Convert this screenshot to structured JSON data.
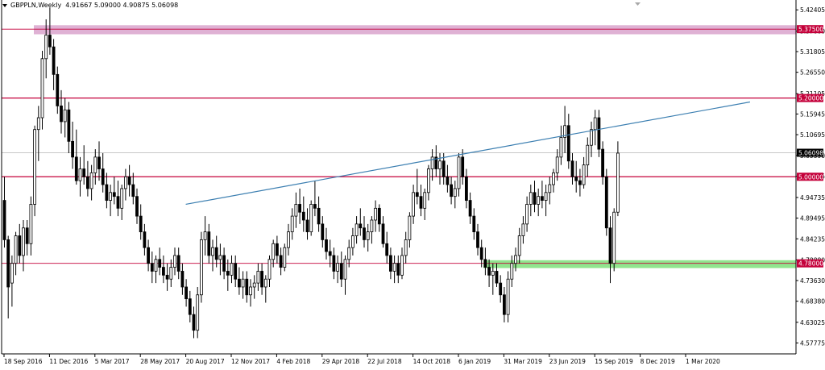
{
  "header": {
    "symbol_timeframe": "GBPPLN,Weekly",
    "ohlc": "4.91667 5.09000 4.90875 5.06098"
  },
  "colors": {
    "background": "#ffffff",
    "candle_outline": "#000000",
    "bull_fill": "#ffffff",
    "bear_fill": "#000000",
    "level_line": "#c4003a",
    "resistance_zone": "#d9a3cc",
    "support_zone": "#7ee07a",
    "trendline": "#3c7fb1",
    "price_label_bg": "#c4003a",
    "price_label_text": "#ffffff",
    "current_price_bg": "#000000"
  },
  "chart_data": {
    "type": "candlestick",
    "title": "GBPPLN,Weekly",
    "ylim": [
      4.55,
      5.445
    ],
    "y_ticks": [
      "5.42405",
      "5.37000",
      "5.31805",
      "5.26550",
      "5.21105",
      "5.15945",
      "5.10695",
      "5.05390",
      "5.00135",
      "4.94735",
      "4.89495",
      "4.84235",
      "4.78880",
      "4.73630",
      "4.68380",
      "4.63025",
      "4.57775"
    ],
    "x_labels": [
      "18 Sep 2016",
      "11 Dec 2016",
      "5 Mar 2017",
      "28 May 2017",
      "20 Aug 2017",
      "12 Nov 2017",
      "4 Feb 2018",
      "29 Apr 2018",
      "22 Jul 2018",
      "14 Oct 2018",
      "6 Jan 2019",
      "31 Mar 2019",
      "23 Jun 2019",
      "15 Sep 2019",
      "8 Dec 2019",
      "1 Mar 2020"
    ],
    "horizontal_levels": [
      {
        "value": 5.375,
        "label": "5.37500"
      },
      {
        "value": 5.2,
        "label": "5.20000"
      },
      {
        "value": 5.0,
        "label": "5.00000"
      },
      {
        "value": 4.78,
        "label": "4.78000"
      }
    ],
    "current_price": {
      "value": 5.06098,
      "label": "5.06098"
    },
    "zones": [
      {
        "name": "resistance",
        "from": 5.362,
        "to": 5.385
      },
      {
        "name": "support",
        "from": 4.768,
        "to": 4.788
      }
    ],
    "trendline": {
      "start": [
        "2017-08-20",
        4.93
      ],
      "end": [
        "2020-06-28",
        5.19
      ]
    },
    "series": [
      {
        "ohlc": [
          [
            4.94,
            5.0,
            4.82,
            4.84
          ],
          [
            4.84,
            4.85,
            4.64,
            4.72
          ],
          [
            4.73,
            4.8,
            4.67,
            4.78
          ],
          [
            4.78,
            4.86,
            4.75,
            4.85
          ],
          [
            4.85,
            4.88,
            4.78,
            4.8
          ],
          [
            4.8,
            4.89,
            4.76,
            4.87
          ],
          [
            4.87,
            4.89,
            4.8,
            4.83
          ],
          [
            4.83,
            4.95,
            4.8,
            4.93
          ],
          [
            4.93,
            5.13,
            4.9,
            5.12
          ],
          [
            5.12,
            5.18,
            5.04,
            5.15
          ],
          [
            5.15,
            5.32,
            5.12,
            5.3
          ],
          [
            5.3,
            5.4,
            5.25,
            5.36
          ],
          [
            5.36,
            5.43,
            5.31,
            5.33
          ],
          [
            5.33,
            5.35,
            5.22,
            5.26
          ],
          [
            5.26,
            5.28,
            5.16,
            5.18
          ],
          [
            5.18,
            5.22,
            5.11,
            5.14
          ],
          [
            5.14,
            5.2,
            5.1,
            5.17
          ],
          [
            5.17,
            5.19,
            5.06,
            5.09
          ],
          [
            5.09,
            5.14,
            5.02,
            5.05
          ],
          [
            5.05,
            5.12,
            4.98,
            4.99
          ],
          [
            4.99,
            5.05,
            4.95,
            5.02
          ],
          [
            5.02,
            5.08,
            4.98,
            5.0
          ],
          [
            5.0,
            5.04,
            4.95,
            4.97
          ],
          [
            4.97,
            5.03,
            4.94,
            5.01
          ],
          [
            5.01,
            5.07,
            4.98,
            5.05
          ],
          [
            5.05,
            5.09,
            4.99,
            5.02
          ],
          [
            5.02,
            5.06,
            4.96,
            4.98
          ],
          [
            4.98,
            5.01,
            4.92,
            4.94
          ],
          [
            4.94,
            4.98,
            4.9,
            4.96
          ],
          [
            4.96,
            5.0,
            4.93,
            4.95
          ],
          [
            4.95,
            4.99,
            4.9,
            4.92
          ],
          [
            4.92,
            4.98,
            4.89,
            4.97
          ],
          [
            4.97,
            5.02,
            4.94,
            5.0
          ],
          [
            5.0,
            5.03,
            4.95,
            4.98
          ],
          [
            4.98,
            5.01,
            4.93,
            4.95
          ],
          [
            4.95,
            4.97,
            4.88,
            4.9
          ],
          [
            4.9,
            4.93,
            4.84,
            4.86
          ],
          [
            4.86,
            4.88,
            4.8,
            4.82
          ],
          [
            4.82,
            4.84,
            4.76,
            4.78
          ],
          [
            4.78,
            4.81,
            4.73,
            4.76
          ],
          [
            4.76,
            4.8,
            4.73,
            4.79
          ],
          [
            4.79,
            4.82,
            4.75,
            4.77
          ],
          [
            4.77,
            4.8,
            4.73,
            4.75
          ],
          [
            4.75,
            4.78,
            4.71,
            4.74
          ],
          [
            4.74,
            4.79,
            4.72,
            4.77
          ],
          [
            4.77,
            4.82,
            4.75,
            4.8
          ],
          [
            4.8,
            4.82,
            4.74,
            4.76
          ],
          [
            4.76,
            4.78,
            4.7,
            4.72
          ],
          [
            4.72,
            4.74,
            4.67,
            4.69
          ],
          [
            4.69,
            4.71,
            4.63,
            4.65
          ],
          [
            4.65,
            4.67,
            4.59,
            4.61
          ],
          [
            4.61,
            4.72,
            4.59,
            4.7
          ],
          [
            4.7,
            4.86,
            4.68,
            4.84
          ],
          [
            4.84,
            4.9,
            4.8,
            4.86
          ],
          [
            4.86,
            4.88,
            4.78,
            4.8
          ],
          [
            4.8,
            4.84,
            4.76,
            4.82
          ],
          [
            4.82,
            4.85,
            4.77,
            4.79
          ],
          [
            4.79,
            4.83,
            4.75,
            4.8
          ],
          [
            4.8,
            4.82,
            4.74,
            4.76
          ],
          [
            4.76,
            4.79,
            4.71,
            4.75
          ],
          [
            4.75,
            4.8,
            4.73,
            4.78
          ],
          [
            4.78,
            4.8,
            4.72,
            4.74
          ],
          [
            4.74,
            4.77,
            4.7,
            4.72
          ],
          [
            4.72,
            4.76,
            4.69,
            4.74
          ],
          [
            4.74,
            4.76,
            4.68,
            4.7
          ],
          [
            4.7,
            4.74,
            4.67,
            4.72
          ],
          [
            4.72,
            4.75,
            4.69,
            4.73
          ],
          [
            4.73,
            4.78,
            4.71,
            4.76
          ],
          [
            4.76,
            4.78,
            4.7,
            4.72
          ],
          [
            4.72,
            4.75,
            4.68,
            4.74
          ],
          [
            4.74,
            4.8,
            4.72,
            4.79
          ],
          [
            4.79,
            4.84,
            4.77,
            4.83
          ],
          [
            4.83,
            4.85,
            4.78,
            4.8
          ],
          [
            4.8,
            4.82,
            4.75,
            4.77
          ],
          [
            4.77,
            4.83,
            4.76,
            4.82
          ],
          [
            4.82,
            4.88,
            4.8,
            4.86
          ],
          [
            4.86,
            4.92,
            4.84,
            4.9
          ],
          [
            4.9,
            4.96,
            4.87,
            4.93
          ],
          [
            4.93,
            4.97,
            4.88,
            4.91
          ],
          [
            4.91,
            4.95,
            4.86,
            4.89
          ],
          [
            4.89,
            4.92,
            4.84,
            4.86
          ],
          [
            4.86,
            4.94,
            4.85,
            4.93
          ],
          [
            4.93,
            4.99,
            4.9,
            4.92
          ],
          [
            4.92,
            4.95,
            4.86,
            4.88
          ],
          [
            4.88,
            4.9,
            4.82,
            4.84
          ],
          [
            4.84,
            4.87,
            4.79,
            4.81
          ],
          [
            4.81,
            4.84,
            4.77,
            4.8
          ],
          [
            4.8,
            4.82,
            4.74,
            4.76
          ],
          [
            4.76,
            4.8,
            4.73,
            4.78
          ],
          [
            4.78,
            4.81,
            4.72,
            4.74
          ],
          [
            4.74,
            4.8,
            4.7,
            4.79
          ],
          [
            4.79,
            4.84,
            4.77,
            4.82
          ],
          [
            4.82,
            4.87,
            4.8,
            4.85
          ],
          [
            4.85,
            4.9,
            4.83,
            4.88
          ],
          [
            4.88,
            4.92,
            4.85,
            4.87
          ],
          [
            4.87,
            4.9,
            4.82,
            4.84
          ],
          [
            4.84,
            4.88,
            4.81,
            4.86
          ],
          [
            4.86,
            4.9,
            4.83,
            4.89
          ],
          [
            4.89,
            4.94,
            4.86,
            4.92
          ],
          [
            4.92,
            4.93,
            4.86,
            4.88
          ],
          [
            4.88,
            4.9,
            4.82,
            4.83
          ],
          [
            4.83,
            4.86,
            4.78,
            4.8
          ],
          [
            4.8,
            4.82,
            4.74,
            4.76
          ],
          [
            4.76,
            4.8,
            4.73,
            4.78
          ],
          [
            4.78,
            4.8,
            4.73,
            4.75
          ],
          [
            4.75,
            4.82,
            4.74,
            4.8
          ],
          [
            4.8,
            4.86,
            4.78,
            4.84
          ],
          [
            4.84,
            4.91,
            4.82,
            4.9
          ],
          [
            4.9,
            4.98,
            4.88,
            4.96
          ],
          [
            4.96,
            5.02,
            4.93,
            4.95
          ],
          [
            4.95,
            4.98,
            4.9,
            4.92
          ],
          [
            4.92,
            4.97,
            4.89,
            4.96
          ],
          [
            4.96,
            5.03,
            4.94,
            5.02
          ],
          [
            5.02,
            5.07,
            4.99,
            5.05
          ],
          [
            5.05,
            5.08,
            5.0,
            5.02
          ],
          [
            5.02,
            5.06,
            4.98,
            5.04
          ],
          [
            5.04,
            5.06,
            4.98,
            5.0
          ],
          [
            5.0,
            5.03,
            4.96,
            4.98
          ],
          [
            4.98,
            5.0,
            4.93,
            4.95
          ],
          [
            4.95,
            4.99,
            4.92,
            4.97
          ],
          [
            4.97,
            5.06,
            4.95,
            5.05
          ],
          [
            5.05,
            5.07,
            4.98,
            5.0
          ],
          [
            5.0,
            5.02,
            4.92,
            4.94
          ],
          [
            4.94,
            4.96,
            4.88,
            4.9
          ],
          [
            4.9,
            4.92,
            4.84,
            4.86
          ],
          [
            4.86,
            4.88,
            4.8,
            4.82
          ],
          [
            4.82,
            4.84,
            4.77,
            4.79
          ],
          [
            4.79,
            4.82,
            4.75,
            4.77
          ],
          [
            4.77,
            4.79,
            4.72,
            4.75
          ],
          [
            4.75,
            4.78,
            4.7,
            4.76
          ],
          [
            4.76,
            4.78,
            4.72,
            4.73
          ],
          [
            4.73,
            4.75,
            4.68,
            4.7
          ],
          [
            4.7,
            4.72,
            4.63,
            4.65
          ],
          [
            4.65,
            4.76,
            4.63,
            4.74
          ],
          [
            4.74,
            4.8,
            4.72,
            4.78
          ],
          [
            4.78,
            4.82,
            4.76,
            4.8
          ],
          [
            4.8,
            4.87,
            4.78,
            4.85
          ],
          [
            4.85,
            4.9,
            4.83,
            4.88
          ],
          [
            4.88,
            4.95,
            4.86,
            4.93
          ],
          [
            4.93,
            4.98,
            4.9,
            4.96
          ],
          [
            4.96,
            4.99,
            4.91,
            4.93
          ],
          [
            4.93,
            4.97,
            4.9,
            4.95
          ],
          [
            4.95,
            4.99,
            4.92,
            4.94
          ],
          [
            4.94,
            4.98,
            4.9,
            4.96
          ],
          [
            4.96,
            5.0,
            4.93,
            4.98
          ],
          [
            4.98,
            5.02,
            4.96,
            5.01
          ],
          [
            5.01,
            5.07,
            4.99,
            5.05
          ],
          [
            5.05,
            5.13,
            5.03,
            5.1
          ],
          [
            5.1,
            5.18,
            5.06,
            5.13
          ],
          [
            5.13,
            5.16,
            5.02,
            5.04
          ],
          [
            5.04,
            5.06,
            4.98,
            5.0
          ],
          [
            5.0,
            5.04,
            4.96,
            4.99
          ],
          [
            4.99,
            5.02,
            4.95,
            4.98
          ],
          [
            4.98,
            5.05,
            4.97,
            5.03
          ],
          [
            5.03,
            5.1,
            5.0,
            5.08
          ],
          [
            5.08,
            5.14,
            5.05,
            5.12
          ],
          [
            5.12,
            5.17,
            5.08,
            5.15
          ],
          [
            5.15,
            5.17,
            5.05,
            5.07
          ],
          [
            5.07,
            5.09,
            4.98,
            5.0
          ],
          [
            5.0,
            5.02,
            4.85,
            4.87
          ],
          [
            4.87,
            4.9,
            4.73,
            4.78
          ],
          [
            4.78,
            4.92,
            4.76,
            4.91
          ],
          [
            4.91,
            5.09,
            4.9,
            5.06
          ]
        ]
      }
    ]
  }
}
